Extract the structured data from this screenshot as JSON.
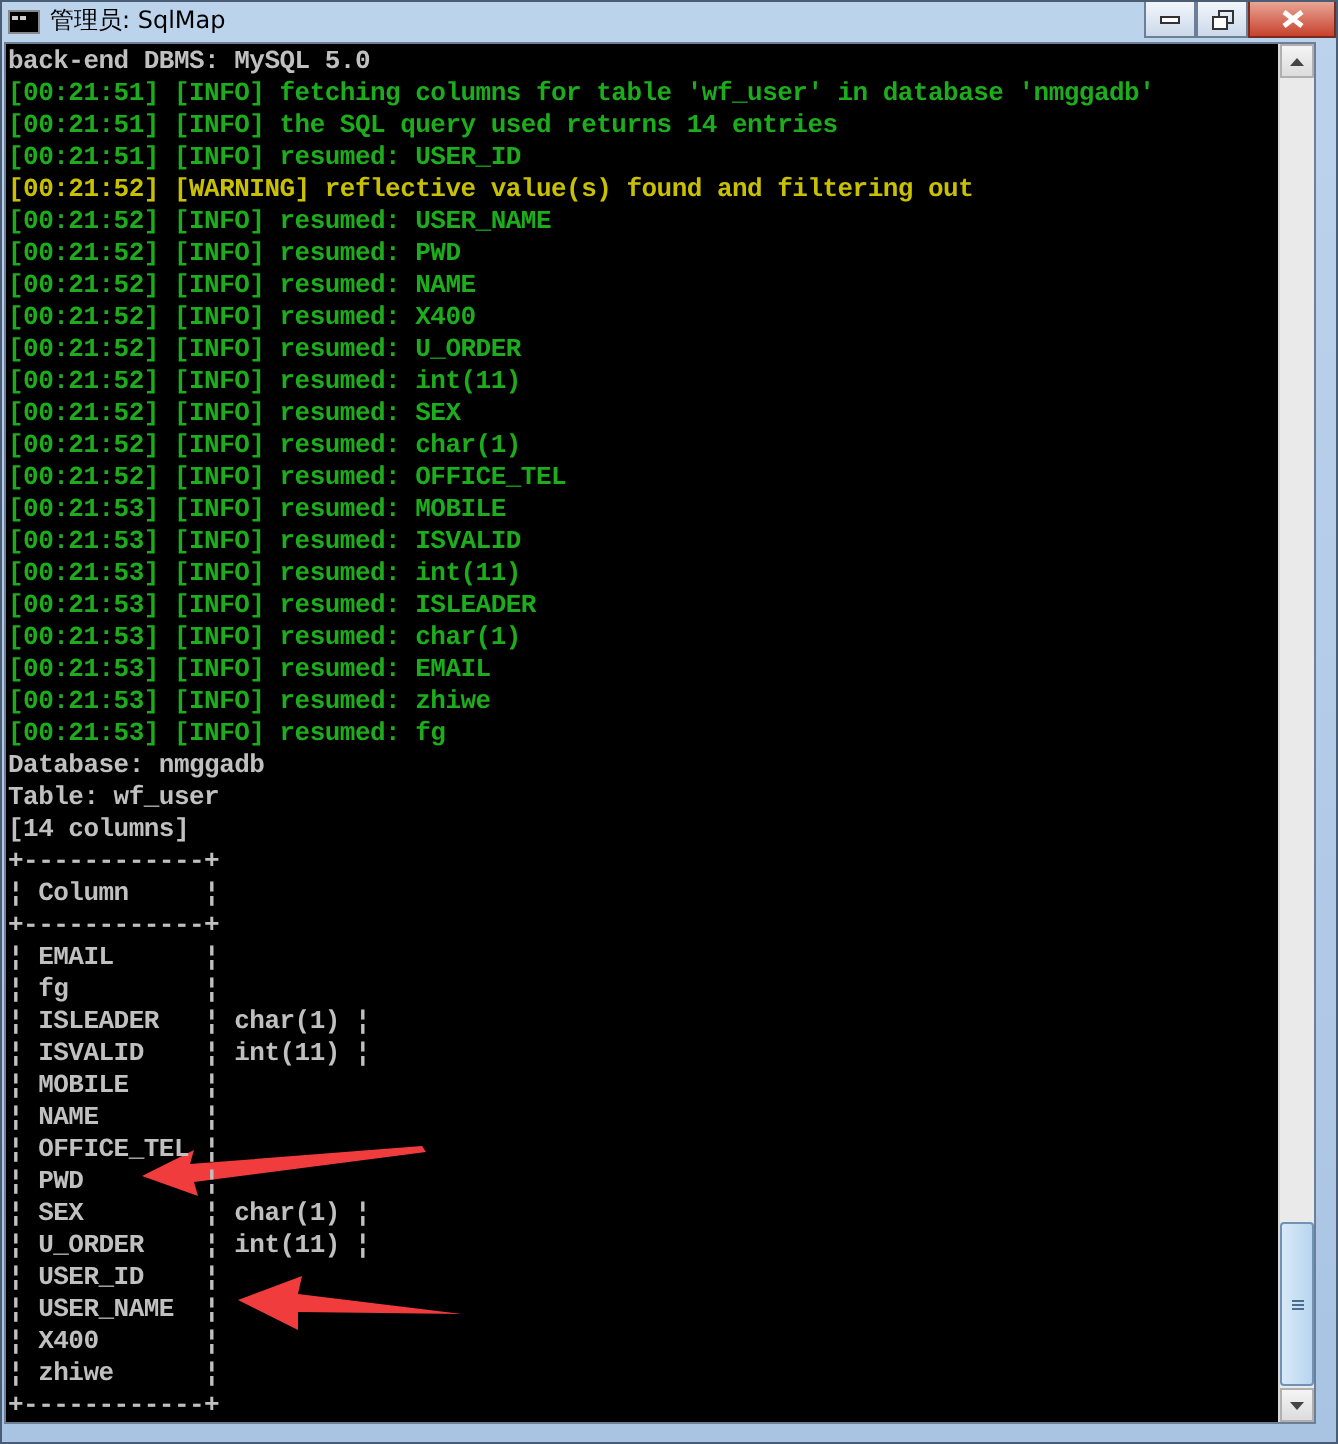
{
  "window": {
    "title": "管理员: SqlMap"
  },
  "console": {
    "lines": [
      {
        "kind": "plain",
        "text": "back-end DBMS: MySQL 5.0"
      },
      {
        "kind": "info",
        "text": "[00:21:51] [INFO] fetching columns for table 'wf_user' in database 'nmggadb'"
      },
      {
        "kind": "info",
        "text": "[00:21:51] [INFO] the SQL query used returns 14 entries"
      },
      {
        "kind": "info",
        "text": "[00:21:51] [INFO] resumed: USER_ID"
      },
      {
        "kind": "warning",
        "text": "[00:21:52] [WARNING] reflective value(s) found and filtering out"
      },
      {
        "kind": "info",
        "text": "[00:21:52] [INFO] resumed: USER_NAME"
      },
      {
        "kind": "info",
        "text": "[00:21:52] [INFO] resumed: PWD"
      },
      {
        "kind": "info",
        "text": "[00:21:52] [INFO] resumed: NAME"
      },
      {
        "kind": "info",
        "text": "[00:21:52] [INFO] resumed: X400"
      },
      {
        "kind": "info",
        "text": "[00:21:52] [INFO] resumed: U_ORDER"
      },
      {
        "kind": "info",
        "text": "[00:21:52] [INFO] resumed: int(11)"
      },
      {
        "kind": "info",
        "text": "[00:21:52] [INFO] resumed: SEX"
      },
      {
        "kind": "info",
        "text": "[00:21:52] [INFO] resumed: char(1)"
      },
      {
        "kind": "info",
        "text": "[00:21:52] [INFO] resumed: OFFICE_TEL"
      },
      {
        "kind": "info",
        "text": "[00:21:53] [INFO] resumed: MOBILE"
      },
      {
        "kind": "info",
        "text": "[00:21:53] [INFO] resumed: ISVALID"
      },
      {
        "kind": "info",
        "text": "[00:21:53] [INFO] resumed: int(11)"
      },
      {
        "kind": "info",
        "text": "[00:21:53] [INFO] resumed: ISLEADER"
      },
      {
        "kind": "info",
        "text": "[00:21:53] [INFO] resumed: char(1)"
      },
      {
        "kind": "info",
        "text": "[00:21:53] [INFO] resumed: EMAIL"
      },
      {
        "kind": "info",
        "text": "[00:21:53] [INFO] resumed: zhiwe"
      },
      {
        "kind": "info",
        "text": "[00:21:53] [INFO] resumed: fg"
      },
      {
        "kind": "plain",
        "text": "Database: nmggadb"
      },
      {
        "kind": "plain",
        "text": "Table: wf_user"
      },
      {
        "kind": "plain",
        "text": "[14 columns]"
      },
      {
        "kind": "plain",
        "text": "+------------+"
      },
      {
        "kind": "plain",
        "text": "¦ Column     ¦"
      },
      {
        "kind": "plain",
        "text": "+------------+"
      },
      {
        "kind": "plain",
        "text": "¦ EMAIL      ¦"
      },
      {
        "kind": "plain",
        "text": "¦ fg         ¦"
      },
      {
        "kind": "plain",
        "text": "¦ ISLEADER   ¦ char(1) ¦"
      },
      {
        "kind": "plain",
        "text": "¦ ISVALID    ¦ int(11) ¦"
      },
      {
        "kind": "plain",
        "text": "¦ MOBILE     ¦"
      },
      {
        "kind": "plain",
        "text": "¦ NAME       ¦"
      },
      {
        "kind": "plain",
        "text": "¦ OFFICE_TEL ¦"
      },
      {
        "kind": "plain",
        "text": "¦ PWD        ¦"
      },
      {
        "kind": "plain",
        "text": "¦ SEX        ¦ char(1) ¦"
      },
      {
        "kind": "plain",
        "text": "¦ U_ORDER    ¦ int(11) ¦"
      },
      {
        "kind": "plain",
        "text": "¦ USER_ID    ¦"
      },
      {
        "kind": "plain",
        "text": "¦ USER_NAME  ¦"
      },
      {
        "kind": "plain",
        "text": "¦ X400       ¦"
      },
      {
        "kind": "plain",
        "text": "¦ zhiwe      ¦"
      },
      {
        "kind": "plain",
        "text": "+------------+"
      }
    ]
  }
}
